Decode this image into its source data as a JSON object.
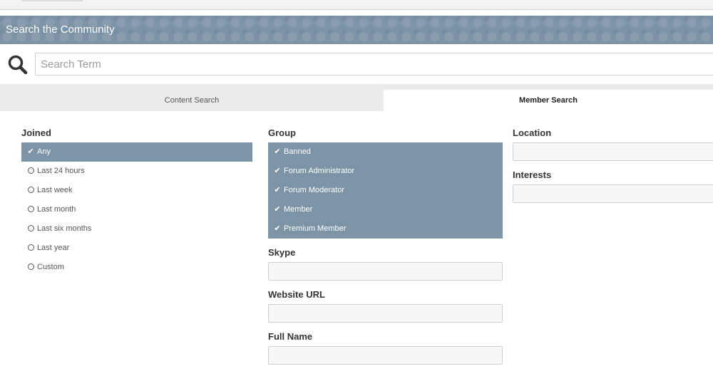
{
  "header": {
    "title": "Search the Community"
  },
  "search": {
    "placeholder": "Search Term",
    "icon": "search-icon"
  },
  "tabs": [
    {
      "label": "Content Search",
      "active": false
    },
    {
      "label": "Member Search",
      "active": true
    }
  ],
  "joined": {
    "label": "Joined",
    "options": [
      {
        "label": "Any",
        "selected": true
      },
      {
        "label": "Last 24 hours",
        "selected": false
      },
      {
        "label": "Last week",
        "selected": false
      },
      {
        "label": "Last month",
        "selected": false
      },
      {
        "label": "Last six months",
        "selected": false
      },
      {
        "label": "Last year",
        "selected": false
      },
      {
        "label": "Custom",
        "selected": false
      }
    ]
  },
  "group": {
    "label": "Group",
    "options": [
      {
        "label": "Banned",
        "selected": true
      },
      {
        "label": "Forum Administrator",
        "selected": true
      },
      {
        "label": "Forum Moderator",
        "selected": true
      },
      {
        "label": "Member",
        "selected": true
      },
      {
        "label": "Premium Member",
        "selected": true
      }
    ]
  },
  "fields": {
    "skype": {
      "label": "Skype",
      "value": ""
    },
    "website_url": {
      "label": "Website URL",
      "value": ""
    },
    "full_name": {
      "label": "Full Name",
      "value": ""
    },
    "location": {
      "label": "Location",
      "value": ""
    },
    "interests": {
      "label": "Interests",
      "value": ""
    }
  },
  "colors": {
    "accent": "#7d93a6",
    "tab_bg": "#ebebeb",
    "field_bg": "#f7f7f7"
  }
}
